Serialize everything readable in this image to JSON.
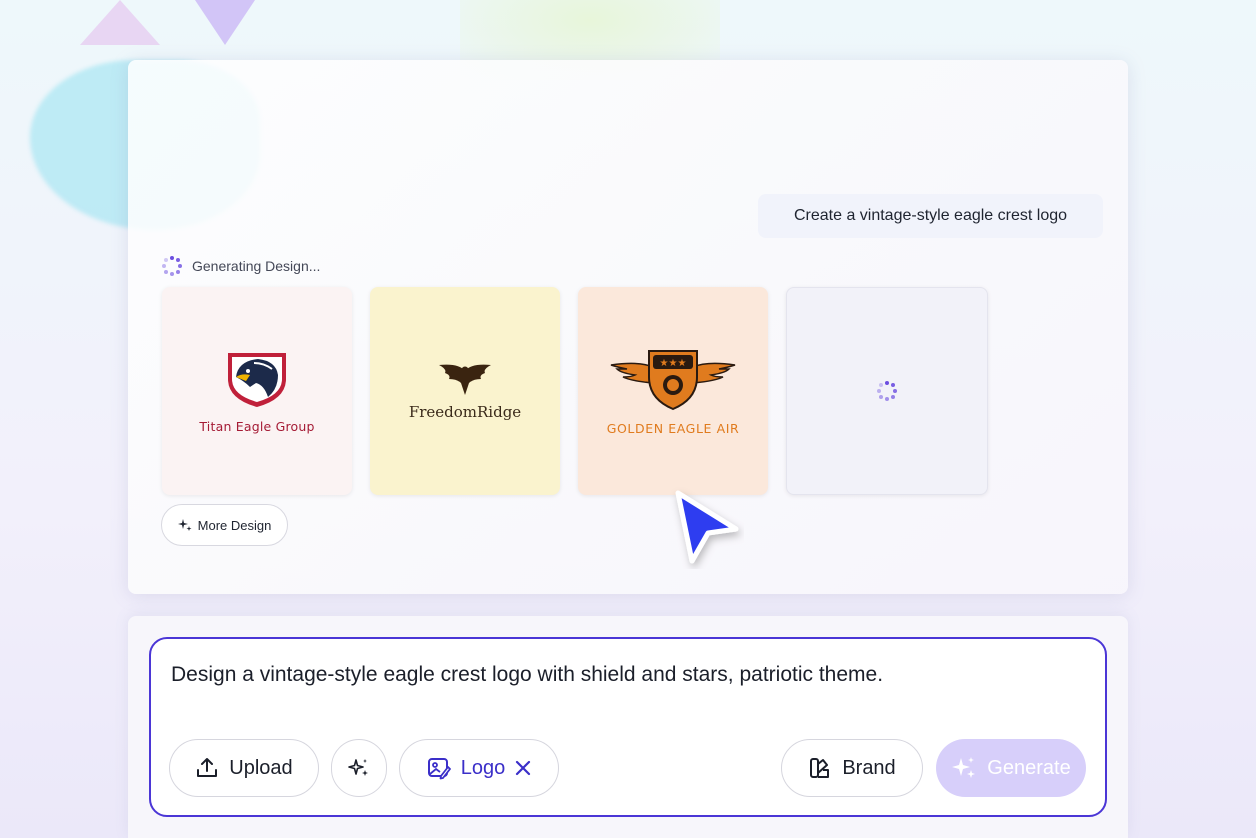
{
  "chat": {
    "user_prompt": "Create a vintage-style eagle crest logo",
    "status_text": "Generating Design..."
  },
  "designs": [
    {
      "name": "Titan Eagle Group",
      "icon": "eagle-head-shield-icon",
      "bg": "#fbf3f3",
      "text_color": "#a51b35"
    },
    {
      "name": "FreedomRidge",
      "icon": "eagle-spread-wings-icon",
      "bg": "#faf3ce",
      "text_color": "#3a2a1a"
    },
    {
      "name": "GOLDEN EAGLE AIR",
      "icon": "winged-eagle-badge-icon",
      "bg": "#fbe8db",
      "text_color": "#e07b1e"
    },
    {
      "name": "",
      "icon": "loading-spinner-icon",
      "bg": "#f2f2f9"
    }
  ],
  "more_design_label": "More Design",
  "composer": {
    "input_value": "Design a vintage-style eagle crest logo with shield and stars, patriotic theme.",
    "upload_label": "Upload",
    "logo_label": "Logo",
    "brand_label": "Brand",
    "generate_label": "Generate"
  },
  "colors": {
    "accent": "#4b36d6",
    "spinner": "#6c4ee0",
    "generate_bg": "#d7cffa",
    "cursor": "#2f3df0"
  }
}
